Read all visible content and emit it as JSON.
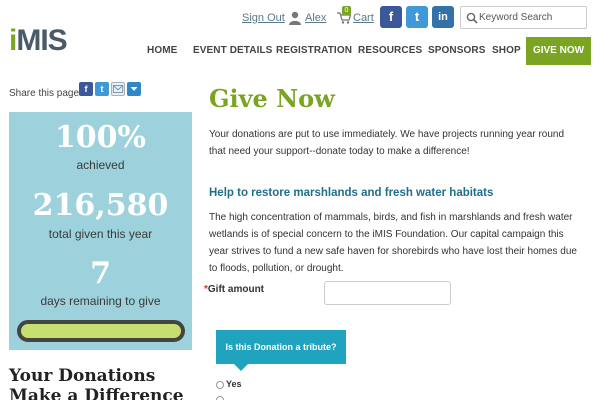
{
  "header": {
    "sign_out": "Sign Out",
    "user_name": "Alex",
    "cart_label": "Cart",
    "cart_count": "0",
    "search_placeholder": "Keyword Search",
    "social": {
      "facebook": "f",
      "twitter": "t",
      "linkedin": "in"
    }
  },
  "logo": {
    "dot": "i",
    "rest": "MIS"
  },
  "nav": {
    "items": [
      "HOME",
      "EVENT DETAILS",
      "REGISTRATION",
      "RESOURCES",
      "SPONSORS",
      "SHOP"
    ],
    "give_now": "GIVE NOW"
  },
  "share": {
    "label": "Share this page"
  },
  "stats": {
    "percent": "100%",
    "percent_label": "achieved",
    "total": "216,580",
    "total_label": "total given this year",
    "days": "7",
    "days_label": "days remaining to give",
    "progress_fraction": 1.0
  },
  "sidebar_heading": {
    "line1": "Your Donations",
    "line2": "Make a Difference"
  },
  "main": {
    "title": "Give Now",
    "intro": "Your donations are put to use immediately. We have projects running year round that need your support--donate today to make a difference!",
    "section_heading": "Help to restore marshlands and fresh water habitats",
    "section_body": "The high concentration of mammals, birds, and fish in marshlands and fresh water wetlands is of special concern to the iMIS Foundation. Our capital campaign this year strives to fund a new safe haven for shorebirds who have lost their homes due to floods, pollution, or drought.",
    "gift_required": "*",
    "gift_label": "Gift amount",
    "gift_value": "",
    "tribute_question": "Is this Donation a tribute?",
    "tribute_yes": "Yes"
  },
  "colors": {
    "brand_green": "#7aa421",
    "stats_bg": "#9dd2dc",
    "tribute_bg": "#1fa3bf",
    "heading_blue": "#1f6f8b",
    "progress_fill": "#c6df6e"
  }
}
